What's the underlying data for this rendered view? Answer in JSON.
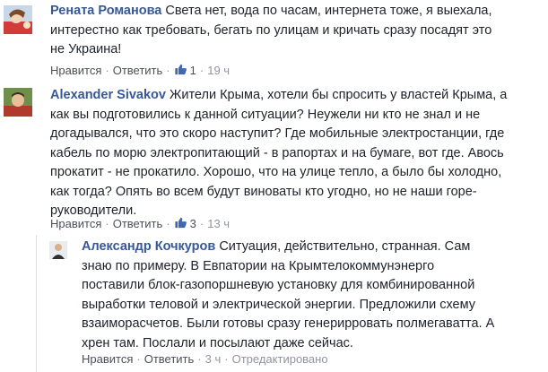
{
  "comments": [
    {
      "author": "Рената Романова",
      "text_lines": [
        "Света нет, вода по часам, интернета тоже, я выехала,",
        "интерестно как требовать, бегать по улицам и кричать сразу посадят это",
        "не Украина!"
      ],
      "like_label": "Нравится",
      "reply_label": "Ответить",
      "like_count": "1",
      "time": "19 ч"
    },
    {
      "author": "Alexander Sivakov",
      "text_lines": [
        "Жители Крыма, хотели бы спросить у властей Крыма, а",
        "как вы подготовились к данной ситуации? Неужели ни кто не знал и не",
        "догадывался, что это скоро наступит? Где мобильные электростанции, где",
        "кабель по морю электропитающий - в рапортах и на бумаге, вот где. Авось",
        "прокатит - не прокатило. Хорошо, что на улице тепло, а было бы холодно,",
        "как тогда? Опять во всем будут виноваты кто угодно, но не наши горе-",
        "руководители."
      ],
      "like_label": "Нравится",
      "reply_label": "Ответить",
      "like_count": "3",
      "time": "13 ч"
    },
    {
      "author": "Александр Кочкуров",
      "text_lines": [
        "Ситуация, действительно, странная. Сам",
        "знаю по примеру. В Евпатории на Крымтелокоммунэнерго",
        "поставили блок-газопоршневую установку для комбинированной",
        "выработки теловой и электрической энергии. Предложили схему",
        "взаиморасчетов. Были готовы сразу генерирровать полмегаватта. А",
        "хрен там. Послали и посылают даже сейчас."
      ],
      "like_label": "Нравится",
      "reply_label": "Ответить",
      "time": "3 ч",
      "edited_label": "Отредактировано"
    }
  ],
  "colors": {
    "author": "#365899",
    "text": "#1d2129",
    "meta": "#90949c",
    "like_icon": "#4267b2"
  },
  "icons": {
    "like": "thumbs-up-icon"
  }
}
